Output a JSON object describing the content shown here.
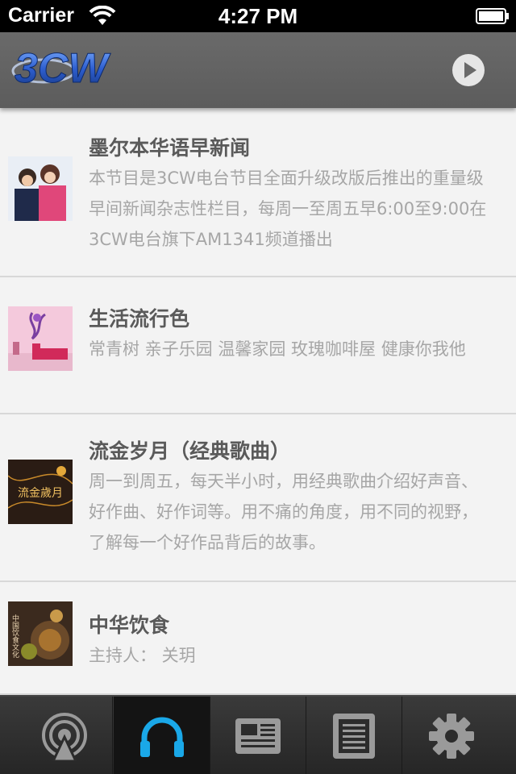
{
  "status_bar": {
    "carrier": "Carrier",
    "time": "4:27 PM"
  },
  "nav_bar": {
    "logo_text": "3CW",
    "accent": "#2f5fc4"
  },
  "programs": [
    {
      "title": "墨尔本华语早新闻",
      "description": "本节目是3CW电台节目全面升级改版后推出的重量级早间新闻杂志性栏目，每周一至周五早6:00至9:00在3CW电台旗下AM1341频道播出"
    },
    {
      "title": "生活流行色",
      "description": "常青树 亲子乐园 温馨家园 玫瑰咖啡屋 健康你我他"
    },
    {
      "title": "流金岁月（经典歌曲）",
      "description": "周一到周五，每天半小时，用经典歌曲介绍好声音、好作曲、好作词等。用不痛的角度，用不同的视野，了解每一个好作品背后的故事。",
      "thumb_text": "流金歲月"
    },
    {
      "title": "中华饮食",
      "description": "主持人： 关玥",
      "thumb_text": "中国饮食文化"
    }
  ],
  "tabs": [
    {
      "icon": "radio-broadcast-icon",
      "active": false
    },
    {
      "icon": "headphones-icon",
      "active": true
    },
    {
      "icon": "newspaper-icon",
      "active": false
    },
    {
      "icon": "document-icon",
      "active": false
    },
    {
      "icon": "gear-icon",
      "active": false
    }
  ],
  "colors": {
    "active_tab_icon": "#1aa8e8",
    "inactive_tab_icon": "#9a9a9a"
  }
}
